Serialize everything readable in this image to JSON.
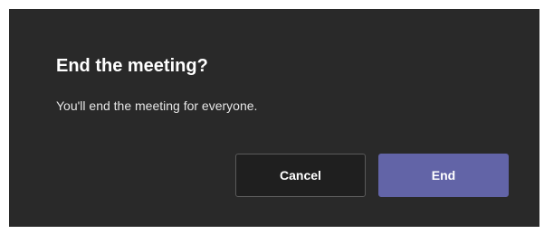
{
  "dialog": {
    "title": "End the meeting?",
    "message": "You'll end the meeting for everyone.",
    "cancel_label": "Cancel",
    "end_label": "End"
  },
  "colors": {
    "dialog_background": "#292929",
    "primary_button": "#6264a7",
    "secondary_button": "#1f1f1f",
    "text": "#ffffff"
  }
}
